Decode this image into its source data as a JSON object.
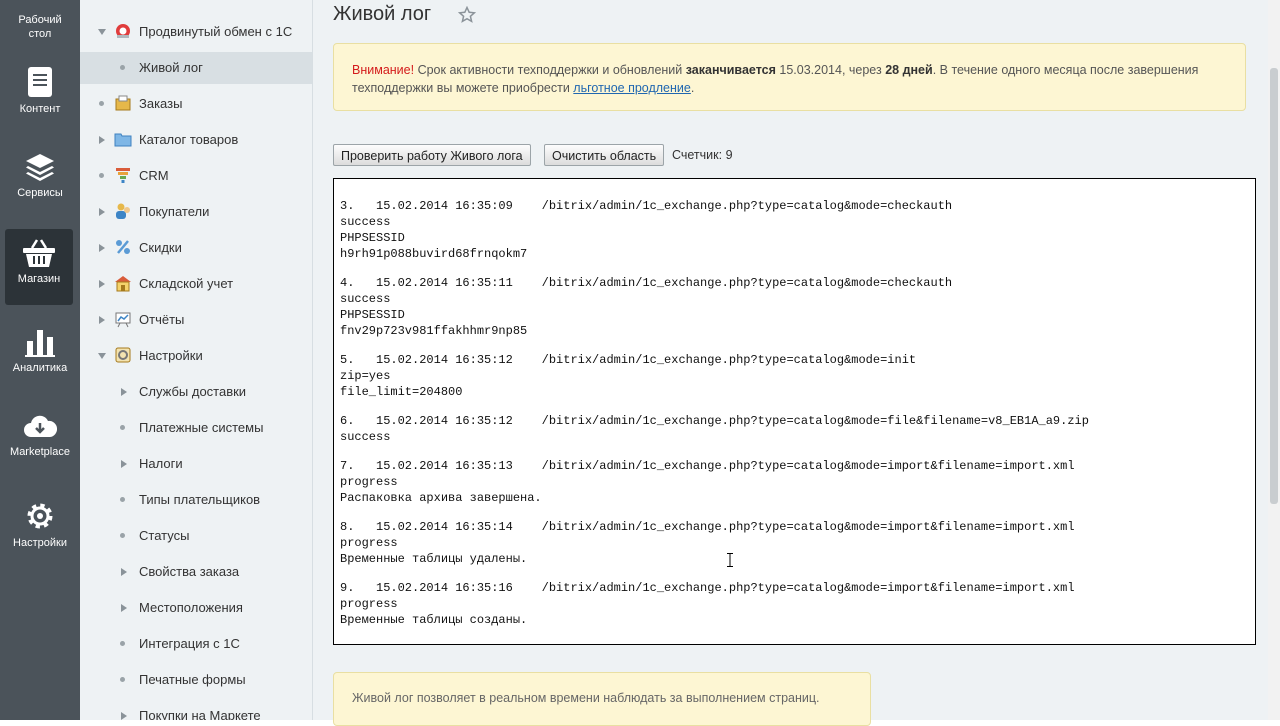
{
  "leftbar": {
    "items": [
      {
        "label": "Рабочий стол",
        "icon": "desktop-icon"
      },
      {
        "label": "Контент",
        "icon": "document-icon"
      },
      {
        "label": "Сервисы",
        "icon": "layers-icon"
      },
      {
        "label": "Магазин",
        "icon": "basket-icon",
        "active": true
      },
      {
        "label": "Аналитика",
        "icon": "bar-chart-icon"
      },
      {
        "label": "Marketplace",
        "icon": "cloud-download-icon"
      },
      {
        "label": "Настройки",
        "icon": "gear-icon"
      }
    ]
  },
  "tree": {
    "items": [
      {
        "label": "Продвинутый обмен с 1С",
        "icon": "exchange-icon"
      },
      {
        "label": "Живой лог"
      },
      {
        "label": "Заказы",
        "icon": "orders-icon"
      },
      {
        "label": "Каталог товаров",
        "icon": "folder-icon"
      },
      {
        "label": "CRM",
        "icon": "crm-funnel-icon"
      },
      {
        "label": "Покупатели",
        "icon": "customers-icon"
      },
      {
        "label": "Скидки",
        "icon": "percent-icon"
      },
      {
        "label": "Складской учет",
        "icon": "warehouse-icon"
      },
      {
        "label": "Отчёты",
        "icon": "reports-icon"
      },
      {
        "label": "Настройки",
        "icon": "settings-icon"
      },
      {
        "label": "Службы доставки"
      },
      {
        "label": "Платежные системы"
      },
      {
        "label": "Налоги"
      },
      {
        "label": "Типы плательщиков"
      },
      {
        "label": "Статусы"
      },
      {
        "label": "Свойства заказа"
      },
      {
        "label": "Местоположения"
      },
      {
        "label": "Интеграция с 1С"
      },
      {
        "label": "Печатные формы"
      },
      {
        "label": "Покупки на Маркете"
      }
    ]
  },
  "page": {
    "title": "Живой лог",
    "notice": {
      "warning": "Внимание!",
      "text1": " Срок активности техподдержки и обновлений ",
      "bold1": "заканчивается",
      "text2": " 15.03.2014, через ",
      "bold2": "28 дней",
      "text3": ". В течение одного месяца после завершения техподдержки вы можете приобрести ",
      "link": "льготное продление",
      "text4": "."
    },
    "buttons": {
      "check": "Проверить работу Живого лога",
      "clear": "Очистить область"
    },
    "counter": "Счетчик: 9",
    "log": [
      "3.   15.02.2014 16:35:09    /bitrix/admin/1c_exchange.php?type=catalog&mode=checkauth\nsuccess\nPHPSESSID\nh9rh91p088buvird68frnqokm7",
      "4.   15.02.2014 16:35:11    /bitrix/admin/1c_exchange.php?type=catalog&mode=checkauth\nsuccess\nPHPSESSID\nfnv29p723v981ffakhhmr9np85",
      "5.   15.02.2014 16:35:12    /bitrix/admin/1c_exchange.php?type=catalog&mode=init\nzip=yes\nfile_limit=204800",
      "6.   15.02.2014 16:35:12    /bitrix/admin/1c_exchange.php?type=catalog&mode=file&filename=v8_EB1A_a9.zip\nsuccess",
      "7.   15.02.2014 16:35:13    /bitrix/admin/1c_exchange.php?type=catalog&mode=import&filename=import.xml\nprogress\nРаспаковка архива завершена.",
      "8.   15.02.2014 16:35:14    /bitrix/admin/1c_exchange.php?type=catalog&mode=import&filename=import.xml\nprogress\nВременные таблицы удалены.",
      "9.   15.02.2014 16:35:16    /bitrix/admin/1c_exchange.php?type=catalog&mode=import&filename=import.xml\nprogress\nВременные таблицы созданы."
    ],
    "info": "Живой лог позволяет в реальном времени наблюдать за выполнением страниц."
  }
}
